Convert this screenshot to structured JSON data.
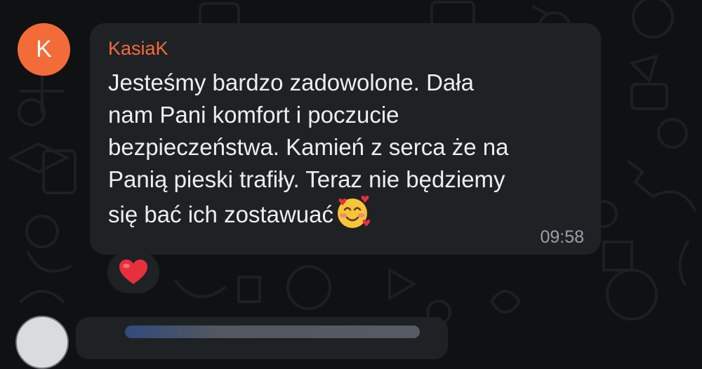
{
  "message": {
    "avatar_letter": "K",
    "sender_name": "KasiaK",
    "text_lines": [
      "Jesteśmy bardzo zadowolone. Dała",
      "nam Pani komfort i poczucie",
      "bezpieczeństwa. Kamień z serca że na",
      "Panią pieski trafiły. Teraz nie będziemy",
      "się bać ich zostawuać"
    ],
    "emoji": "smiling-face-with-hearts",
    "time": "09:58",
    "reaction": "red-heart"
  },
  "colors": {
    "background": "#0f1113",
    "bubble": "#1f2225",
    "accent": "#f26b38",
    "text": "#eceff1",
    "time": "#9ba0a6",
    "heart": "#e8303c"
  }
}
